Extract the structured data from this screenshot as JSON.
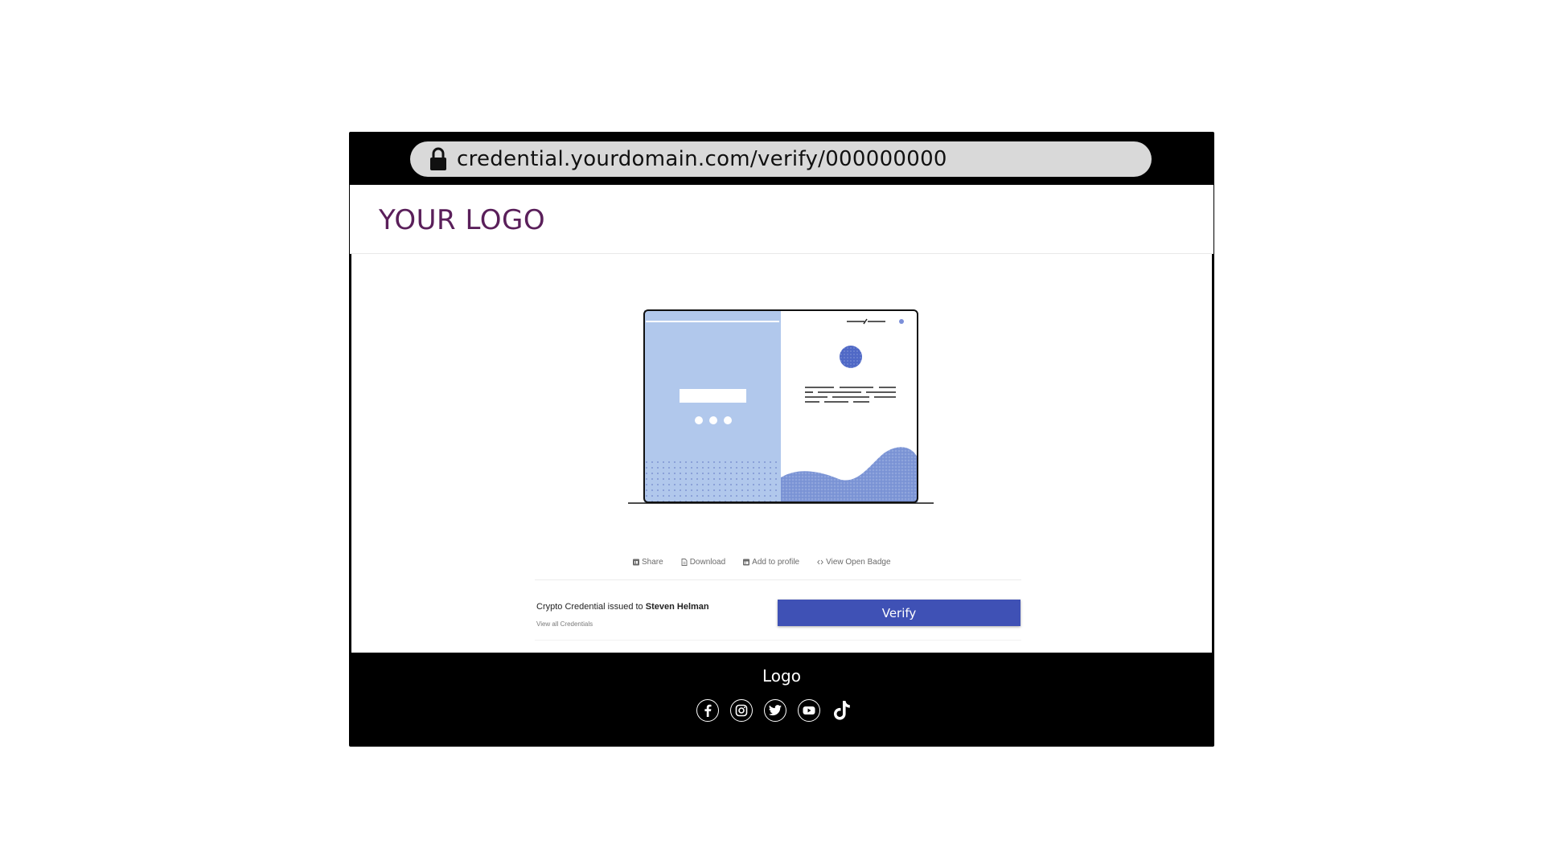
{
  "browser": {
    "url": "credential.yourdomain.com/verify/000000000",
    "lock_icon": "lock-icon"
  },
  "header": {
    "logo_text": "YOUR LOGO",
    "logo_color": "#5a1f5a"
  },
  "actions": [
    {
      "label": "Share",
      "icon": "share-icon"
    },
    {
      "label": "Download",
      "icon": "document-icon"
    },
    {
      "label": "Add to profile",
      "icon": "linkedin-icon"
    },
    {
      "label": "View Open Badge",
      "icon": "code-icon"
    }
  ],
  "credential": {
    "issued_prefix": "Crypto Credential issued to",
    "recipient": "Steven Helman",
    "view_all": "View all Credentials",
    "verify_label": "Verify",
    "accent_color": "#3f51b5"
  },
  "footer": {
    "logo_text": "Logo",
    "socials": [
      "facebook-icon",
      "instagram-icon",
      "twitter-icon",
      "youtube-icon",
      "tiktok-icon"
    ]
  }
}
